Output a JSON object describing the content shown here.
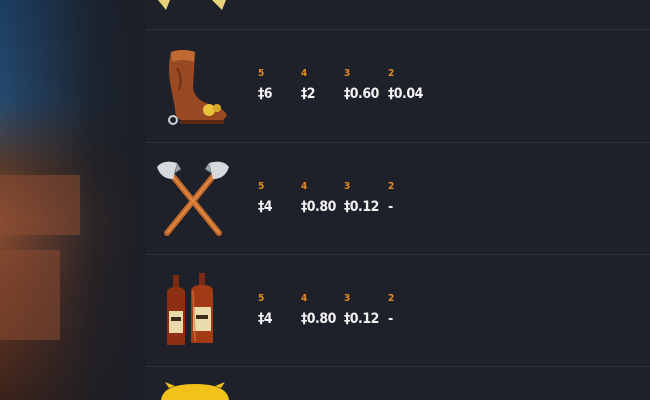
{
  "paytable": {
    "rows": [
      {
        "symbol": "cowboy-boot",
        "pays": [
          {
            "count": "5",
            "amount": "‡6"
          },
          {
            "count": "4",
            "amount": "‡2"
          },
          {
            "count": "3",
            "amount": "‡0.60"
          },
          {
            "count": "2",
            "amount": "‡0.04"
          }
        ]
      },
      {
        "symbol": "crossed-axes",
        "pays": [
          {
            "count": "5",
            "amount": "‡4"
          },
          {
            "count": "4",
            "amount": "‡0.80"
          },
          {
            "count": "3",
            "amount": "‡0.12"
          },
          {
            "count": "2",
            "amount": "-"
          }
        ]
      },
      {
        "symbol": "whiskey-bottles",
        "pays": [
          {
            "count": "5",
            "amount": "‡4"
          },
          {
            "count": "4",
            "amount": "‡0.80"
          },
          {
            "count": "3",
            "amount": "‡0.12"
          },
          {
            "count": "2",
            "amount": "-"
          }
        ]
      }
    ]
  },
  "colors": {
    "background": "#1e212a",
    "count_accent": "#e58a1f",
    "amount_text": "#f2f2f2",
    "divider": "#2c303b"
  }
}
